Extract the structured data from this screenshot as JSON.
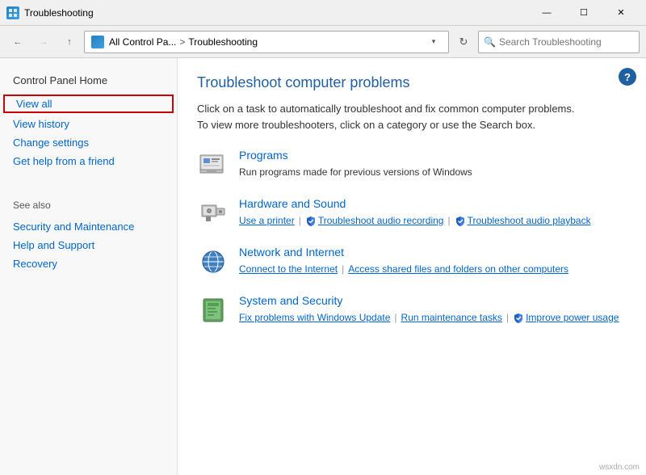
{
  "titleBar": {
    "icon": "control-panel-icon",
    "title": "Troubleshooting",
    "minimizeLabel": "—",
    "maximizeLabel": "☐",
    "closeLabel": "✕"
  },
  "addressBar": {
    "backLabel": "←",
    "forwardLabel": "→",
    "upLabel": "↑",
    "pathIcon": "control-panel-icon",
    "pathPart1": "All Control Pa...",
    "pathSep": ">",
    "pathCurrent": "Troubleshooting",
    "dropdownLabel": "▾",
    "refreshLabel": "↻",
    "searchPlaceholder": "Search Troubleshooting"
  },
  "sidebar": {
    "homeLabel": "Control Panel Home",
    "links": [
      {
        "label": "View all",
        "highlighted": true
      },
      {
        "label": "View history",
        "highlighted": false
      },
      {
        "label": "Change settings",
        "highlighted": false
      },
      {
        "label": "Get help from a friend",
        "highlighted": false
      }
    ],
    "seeAlsoLabel": "See also",
    "seeAlsoLinks": [
      "Security and Maintenance",
      "Help and Support",
      "Recovery"
    ]
  },
  "content": {
    "title": "Troubleshoot computer problems",
    "description": "Click on a task to automatically troubleshoot and fix common computer problems. To view more troubleshooters, click on a category or use the Search box.",
    "helpLabel": "?",
    "categories": [
      {
        "name": "Programs",
        "description": "Run programs made for previous versions of Windows",
        "links": [],
        "iconType": "programs"
      },
      {
        "name": "Hardware and Sound",
        "description": "",
        "links": [
          {
            "label": "Use a printer",
            "shield": false
          },
          {
            "label": "Troubleshoot audio recording",
            "shield": true
          },
          {
            "label": "Troubleshoot audio playback",
            "shield": true
          }
        ],
        "iconType": "hardware"
      },
      {
        "name": "Network and Internet",
        "description": "",
        "links": [
          {
            "label": "Connect to the Internet",
            "shield": false
          },
          {
            "label": "Access shared files and folders on other computers",
            "shield": false
          }
        ],
        "iconType": "network"
      },
      {
        "name": "System and Security",
        "description": "",
        "links": [
          {
            "label": "Fix problems with Windows Update",
            "shield": false
          },
          {
            "label": "Run maintenance tasks",
            "shield": false
          },
          {
            "label": "Improve power usage",
            "shield": true
          }
        ],
        "iconType": "system"
      }
    ]
  },
  "watermark": "wsxdn.com"
}
